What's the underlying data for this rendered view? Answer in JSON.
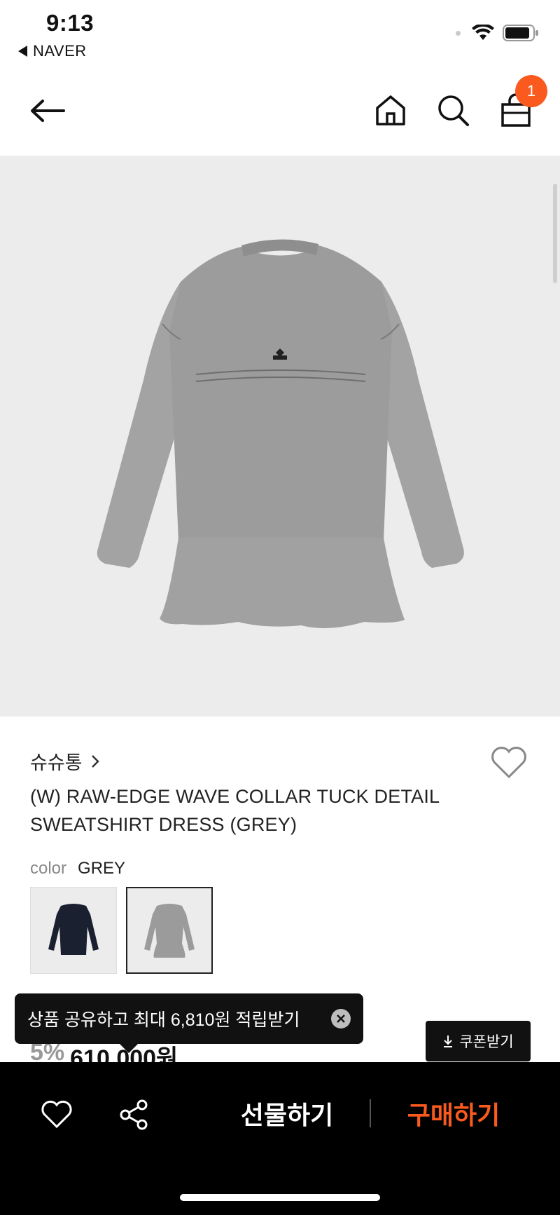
{
  "status_bar": {
    "time": "9:13",
    "back_app": "NAVER"
  },
  "header": {
    "cart_count": "1"
  },
  "product": {
    "brand": "슈슈통",
    "title_line1": "(W) RAW-EDGE WAVE COLLAR TUCK DETAIL",
    "title_line2": "SWEATSHIRT DRESS (GREY)",
    "color_label": "color",
    "color_value": "GREY",
    "discount": "5%",
    "price": "610,000원"
  },
  "toast": {
    "text": "상품 공유하고 최대 6,810원 적립받기"
  },
  "coupon": {
    "label": "쿠폰받기"
  },
  "bottom_bar": {
    "gift_label": "선물하기",
    "buy_label": "구매하기"
  },
  "colors": {
    "accent": "#fa5a1e",
    "garment_grey": "#9b9b9b",
    "garment_navy": "#1b2030"
  },
  "icons": [
    "back-arrow-icon",
    "home-icon",
    "search-icon",
    "cart-icon",
    "heart-icon",
    "share-icon",
    "close-icon",
    "download-icon",
    "wifi-icon",
    "battery-icon"
  ]
}
